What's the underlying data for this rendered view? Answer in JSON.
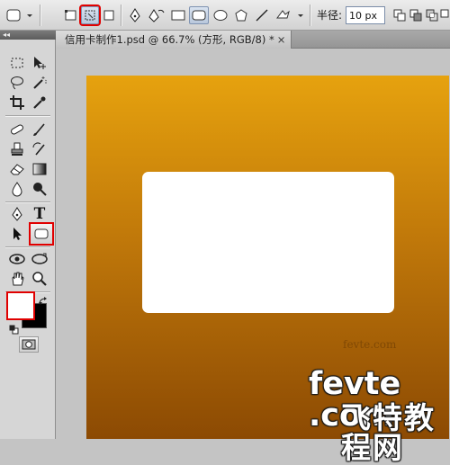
{
  "options_bar": {
    "radius_label": "半径:",
    "radius_value": "10 px"
  },
  "tools": {
    "collapse_glyph": "◂◂",
    "type_tool_letter": "T"
  },
  "document": {
    "tab_title": "信用卡制作1.psd @ 66.7% (方形, RGB/8) *",
    "close_glyph": "×",
    "canvas_gradient": [
      "#e6a20e",
      "#8c4a03"
    ]
  },
  "watermark": {
    "small_text": "fevte.com",
    "latin_text": "fevte .com",
    "cn_text": "飞特教程网"
  }
}
